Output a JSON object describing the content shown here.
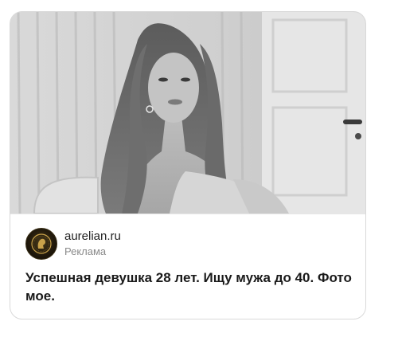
{
  "ad": {
    "domain": "aurelian.ru",
    "label": "Реклама",
    "headline": "Успешная девушка 28 лет. Ищу мужа до 40. Фото мое.",
    "image": "black-and-white photo of a woman with long hair"
  },
  "colors": {
    "card_border": "#d9d9d9",
    "text_primary": "#1a1a1a",
    "text_secondary": "#8a8a8a",
    "avatar_gold": "#c9a24a"
  }
}
